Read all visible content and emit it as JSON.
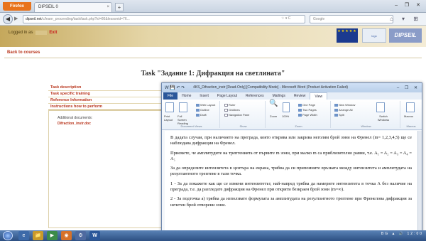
{
  "browser": {
    "app_button": "Firefox",
    "tab_title": "DIPSEIL 0",
    "tab_close": "×",
    "new_tab": "+",
    "window_controls": "– ❐ ✕",
    "back": "◀",
    "forward": "▶",
    "url_domain": "dipseil.net",
    "url_path": "/c/learn_proceeding/task/task.php?id=86&lessonid=76...",
    "url_icons": "☆ ▾ C",
    "search_placeholder": "Google",
    "nav_icons": "⌂ ▾ ⊞"
  },
  "site": {
    "logged_in_label": "Logged in as",
    "username": "user",
    "exit_label": "Exit",
    "eu_stars": "★★★★★",
    "partner_logo_text": "logo",
    "logo_text": "DIPSEIL",
    "back_link": "Back to courses",
    "task_title": "Task \"Задание 1: Дифракция на светлината\"",
    "menu": [
      {
        "label": "Task description"
      },
      {
        "label": "Task specific training"
      },
      {
        "label": "Reference Information"
      },
      {
        "label": "Instructions how to perform"
      }
    ],
    "docs_heading": "Additional documents:",
    "docs_link": "Difraction_instr.doc"
  },
  "word": {
    "qat": "W 💾 ↶ ↷",
    "title": "4KS_Difraction_instr [Read-Only] [Compatibility Mode] - Microsoft Word (Product Activation Failed)",
    "title_buttons": "– ❐ ✕",
    "tabs": [
      {
        "label": "File"
      },
      {
        "label": "Home"
      },
      {
        "label": "Insert"
      },
      {
        "label": "Page Layout"
      },
      {
        "label": "References"
      },
      {
        "label": "Mailings"
      },
      {
        "label": "Review"
      },
      {
        "label": "View"
      }
    ],
    "ribbon": {
      "doc_views_label": "Document Views",
      "print_layout": "Print Layout",
      "full_screen": "Full Screen Reading",
      "web_layout": "Web Layout",
      "outline": "Outline",
      "draft": "Draft",
      "show_label": "Show",
      "ruler": "Ruler",
      "gridlines": "Gridlines",
      "nav_pane": "Navigation Pane",
      "zoom_label": "Zoom",
      "zoom": "Zoom",
      "zoom_100": "100%",
      "one_page": "One Page",
      "two_pages": "Two Pages",
      "page_width": "Page Width",
      "window_label": "Window",
      "new_window": "New Window",
      "arrange_all": "Arrange All",
      "split": "Split",
      "switch_windows": "Switch Windows",
      "macros_label": "Macros",
      "macros": "Macros"
    },
    "paragraphs": [
      "В дадата случаи, при наличието на преграда, която открива или закрива неголям брой зони на Френел (m= 1,2,3,4,5) ще се наблюдава дифракция на Френел.",
      "Приемете, че амплитудите на трептенията от първите m зони, при малко m са приблизително равни, т.е. A₁ = A₂ = A₃ = A₄ = A₅",
      "За да определите интензитета в центъра на екрана, трябва да си припомните връзката между интензитета и амплитудата на резултантното трептене в тази точка.",
      "1 - За да покажете как ще се измени интензитетът, най-напред трябва да намерите интензитета в точка А без наличие на преграда, т.е. да разгледате дифракция на Френел при открити безкраен брой зони (m=∞).",
      "2 - За подточка а) трябва да използвате формулата за амплитудата на резултантното трептене при Френелова дифракция за нечетен брой отворени зони."
    ]
  },
  "taskbar": {
    "items": [
      "e",
      "📁",
      "▶",
      "◉",
      "⚙",
      "W"
    ],
    "tray": "BG ▲ 🔊 12:00"
  }
}
